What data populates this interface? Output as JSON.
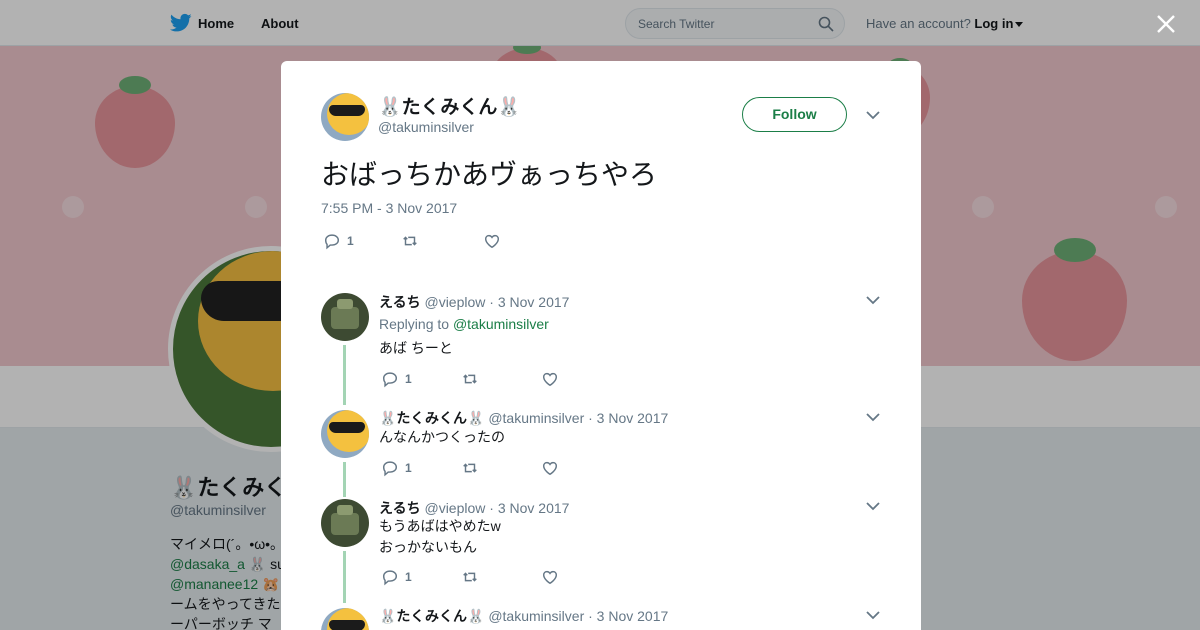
{
  "topnav": {
    "home_label": "Home",
    "about_label": "About",
    "search_placeholder": "Search Twitter",
    "have_account": "Have an account?",
    "login_label": "Log in"
  },
  "colors": {
    "accent": "#1b7e47",
    "banner": "#f2c9cf",
    "thread": "#a3d4b4"
  },
  "background_profile": {
    "name": "🐰たくみく",
    "handle": "@takuminsilver",
    "bio_line1": "マイメロ(´。•ω•。`",
    "bio_link1": "@dasaka_a",
    "bio_rest1": " 🐰 su",
    "bio_link2": "@mananee12",
    "bio_rest2": " 🐹",
    "bio_line4": "ームをやってきた",
    "bio_line5": "ーパーボッチ マ"
  },
  "main_tweet": {
    "name": "🐰たくみくん🐰",
    "handle": "@takuminsilver",
    "follow_label": "Follow",
    "text": "おばっちかあヴぁっちやろ",
    "timestamp": "7:55 PM - 3 Nov 2017",
    "reply_count": "1",
    "retweet_count": "",
    "like_count": ""
  },
  "replies": [
    {
      "name": "えるち",
      "handle": "@vieplow",
      "date": "· 3 Nov 2017",
      "replying_prefix": "Replying to ",
      "replying_to": "@takuminsilver",
      "text": "あば ちーと",
      "reply_count": "1"
    },
    {
      "name": "🐰たくみくん🐰",
      "handle": "@takuminsilver",
      "date": "· 3 Nov 2017",
      "text": "んなんかつくったの",
      "reply_count": "1"
    },
    {
      "name": "えるち",
      "handle": "@vieplow",
      "date": "· 3 Nov 2017",
      "text_line1": "もうあばはやめたw",
      "text_line2": "おっかないもん",
      "reply_count": "1"
    },
    {
      "name": "🐰たくみくん🐰",
      "handle": "@takuminsilver",
      "date": "· 3 Nov 2017"
    }
  ]
}
